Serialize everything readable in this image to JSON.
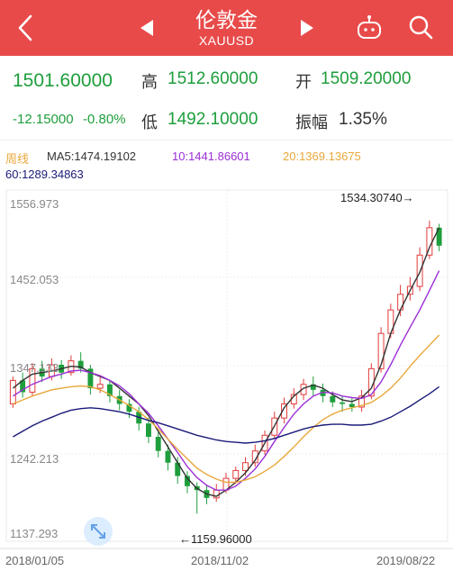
{
  "header": {
    "title": "伦敦金",
    "subtitle": "XAUUSD",
    "icons": {
      "back": "back-chevron-icon",
      "prev": "prev-triangle-icon",
      "next": "next-triangle-icon",
      "robot": "robot-icon",
      "search": "search-icon"
    }
  },
  "quote": {
    "price": "1501.60000",
    "change": "-12.15000",
    "change_pct": "-0.80%",
    "high_label": "高",
    "high": "1512.60000",
    "low_label": "低",
    "low": "1492.10000",
    "open_label": "开",
    "open": "1509.20000",
    "amp_label": "振幅",
    "amp": "1.35%"
  },
  "indicators": {
    "period": "周线",
    "ma5": "MA5:1474.19102",
    "ma10": "10:1441.86601",
    "ma20": "20:1369.13675",
    "ma60": "60:1289.34863"
  },
  "colors": {
    "brand_red": "#e84a4a",
    "up": "#e23b3b",
    "down": "#1e9e3c",
    "ma5": "#333333",
    "ma10": "#9b2fd6",
    "ma20": "#e8a83a",
    "ma60": "#1a1a7a"
  },
  "chart_data": {
    "type": "candlestick",
    "y_ticks": [
      "1556.973",
      "1452.053",
      "1347.133",
      "1242.213",
      "1137.293"
    ],
    "x_ticks": [
      "2018/01/05",
      "2018/11/02",
      "2019/08/22"
    ],
    "annotations": {
      "high": "1534.30740→",
      "low": "←1159.96000"
    },
    "ylim": [
      1137.293,
      1556.973
    ],
    "series": [
      {
        "name": "MA5",
        "values": [
          1320,
          1330,
          1338,
          1340,
          1342,
          1345,
          1348,
          1347,
          1340,
          1335,
          1330,
          1320,
          1310,
          1300,
          1285,
          1265,
          1245,
          1225,
          1205,
          1192,
          1185,
          1182,
          1190,
          1200,
          1212,
          1228,
          1250,
          1272,
          1295,
          1310,
          1320,
          1324,
          1320,
          1312,
          1305,
          1303,
          1308,
          1320,
          1350,
          1390,
          1420,
          1445,
          1468,
          1500,
          1525
        ]
      },
      {
        "name": "MA10",
        "values": [
          1310,
          1318,
          1325,
          1330,
          1335,
          1338,
          1342,
          1343,
          1340,
          1336,
          1330,
          1323,
          1313,
          1300,
          1288,
          1272,
          1255,
          1238,
          1220,
          1206,
          1196,
          1190,
          1190,
          1195,
          1205,
          1217,
          1233,
          1252,
          1270,
          1287,
          1300,
          1310,
          1315,
          1314,
          1310,
          1308,
          1307,
          1312,
          1328,
          1350,
          1375,
          1398,
          1420,
          1445,
          1470
        ]
      },
      {
        "name": "MA20",
        "values": [
          1300,
          1305,
          1310,
          1314,
          1318,
          1320,
          1322,
          1323,
          1322,
          1318,
          1312,
          1305,
          1298,
          1290,
          1280,
          1268,
          1255,
          1242,
          1230,
          1218,
          1210,
          1204,
          1200,
          1200,
          1203,
          1207,
          1214,
          1222,
          1233,
          1245,
          1258,
          1270,
          1280,
          1287,
          1292,
          1295,
          1298,
          1302,
          1310,
          1320,
          1333,
          1348,
          1362,
          1375,
          1388
        ]
      },
      {
        "name": "MA60",
        "values": [
          1258,
          1265,
          1272,
          1278,
          1283,
          1288,
          1292,
          1294,
          1295,
          1294,
          1292,
          1290,
          1287,
          1283,
          1279,
          1276,
          1272,
          1268,
          1264,
          1260,
          1257,
          1254,
          1252,
          1251,
          1250,
          1251,
          1253,
          1256,
          1260,
          1264,
          1268,
          1271,
          1273,
          1274,
          1274,
          1273,
          1273,
          1274,
          1278,
          1283,
          1290,
          1297,
          1305,
          1313,
          1322
        ]
      }
    ],
    "candles": [
      [
        1300,
        1330,
        1335,
        1295
      ],
      [
        1330,
        1315,
        1340,
        1308
      ],
      [
        1315,
        1345,
        1352,
        1310
      ],
      [
        1345,
        1335,
        1355,
        1328
      ],
      [
        1335,
        1350,
        1358,
        1330
      ],
      [
        1350,
        1340,
        1356,
        1332
      ],
      [
        1340,
        1355,
        1362,
        1336
      ],
      [
        1355,
        1345,
        1366,
        1340
      ],
      [
        1345,
        1320,
        1350,
        1312
      ],
      [
        1320,
        1325,
        1334,
        1314
      ],
      [
        1325,
        1310,
        1330,
        1302
      ],
      [
        1310,
        1300,
        1318,
        1292
      ],
      [
        1300,
        1290,
        1306,
        1282
      ],
      [
        1290,
        1275,
        1296,
        1266
      ],
      [
        1275,
        1258,
        1282,
        1250
      ],
      [
        1258,
        1240,
        1264,
        1232
      ],
      [
        1240,
        1225,
        1248,
        1215
      ],
      [
        1225,
        1208,
        1232,
        1198
      ],
      [
        1208,
        1195,
        1214,
        1186
      ],
      [
        1195,
        1190,
        1200,
        1160
      ],
      [
        1190,
        1180,
        1196,
        1172
      ],
      [
        1180,
        1190,
        1198,
        1175
      ],
      [
        1190,
        1205,
        1212,
        1186
      ],
      [
        1205,
        1215,
        1220,
        1198
      ],
      [
        1215,
        1225,
        1232,
        1208
      ],
      [
        1225,
        1240,
        1248,
        1220
      ],
      [
        1240,
        1260,
        1266,
        1235
      ],
      [
        1260,
        1282,
        1290,
        1255
      ],
      [
        1282,
        1300,
        1308,
        1275
      ],
      [
        1300,
        1312,
        1320,
        1294
      ],
      [
        1312,
        1325,
        1332,
        1305
      ],
      [
        1325,
        1318,
        1335,
        1310
      ],
      [
        1318,
        1310,
        1326,
        1302
      ],
      [
        1310,
        1302,
        1316,
        1296
      ],
      [
        1302,
        1300,
        1310,
        1290
      ],
      [
        1300,
        1296,
        1308,
        1290
      ],
      [
        1296,
        1310,
        1318,
        1290
      ],
      [
        1310,
        1345,
        1352,
        1306
      ],
      [
        1345,
        1390,
        1398,
        1340
      ],
      [
        1390,
        1420,
        1428,
        1384
      ],
      [
        1420,
        1440,
        1452,
        1412
      ],
      [
        1440,
        1450,
        1462,
        1432
      ],
      [
        1450,
        1490,
        1500,
        1444
      ],
      [
        1490,
        1525,
        1534,
        1485
      ],
      [
        1525,
        1502,
        1530,
        1495
      ]
    ]
  }
}
